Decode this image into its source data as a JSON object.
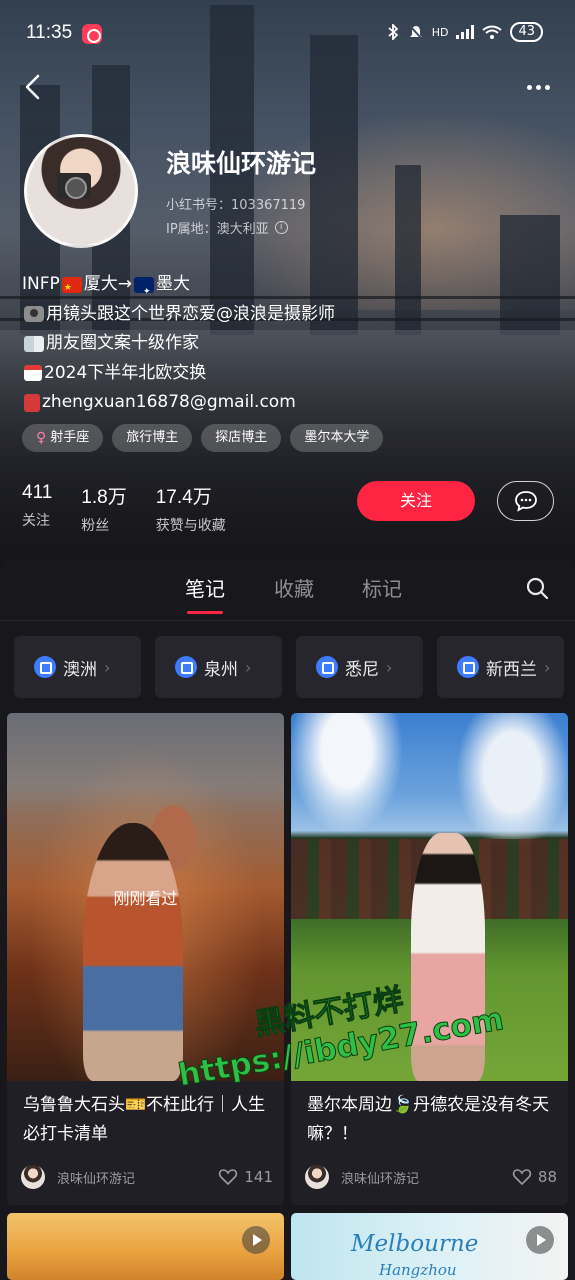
{
  "status_bar": {
    "time": "11:35",
    "network": "HD",
    "battery": "43"
  },
  "profile": {
    "nickname": "浪味仙环游记",
    "red_id": "小红书号：103367119",
    "ip_location": "IP属地：澳大利亚",
    "bio": {
      "line1_a": "INFP",
      "line1_b": "厦大→",
      "line1_c": "墨大",
      "line2": "用镜头跟这个世界恋爱@浪浪是摄影师",
      "line3": "朋友圈文案十级作家",
      "line4": "2024下半年北欧交换",
      "line5": "zhengxuan16878@gmail.com"
    },
    "tags": [
      "射手座",
      "旅行博主",
      "探店博主",
      "墨尔本大学"
    ],
    "stats": [
      {
        "num": "411",
        "label": "关注"
      },
      {
        "num": "1.8万",
        "label": "粉丝"
      },
      {
        "num": "17.4万",
        "label": "获赞与收藏"
      }
    ],
    "follow_label": "关注"
  },
  "tabs": [
    "笔记",
    "收藏",
    "标记"
  ],
  "active_tab": "笔记",
  "collections": [
    "澳洲",
    "泉州",
    "悉尼",
    "新西兰"
  ],
  "notes": [
    {
      "overlay": "刚刚看过",
      "title": "乌鲁鲁大石头🎫不枉此行｜人生必打卡清单",
      "author": "浪味仙环游记",
      "likes": "141"
    },
    {
      "title": "墨尔本周边🍃丹德农是没有冬天嘛？！",
      "author": "浪味仙环游记",
      "likes": "88"
    },
    {
      "title": "",
      "author": "",
      "likes": ""
    },
    {
      "image_text_1": "Melbourne",
      "image_text_2": "Hangzhou"
    }
  ],
  "watermark": {
    "line1": "黑料不打烊",
    "line2": "https://ibdy27.com"
  },
  "colors": {
    "accent": "#ff2442",
    "background": "#17171c",
    "card": "#1f1f25",
    "collection_icon": "#3d7bff"
  }
}
